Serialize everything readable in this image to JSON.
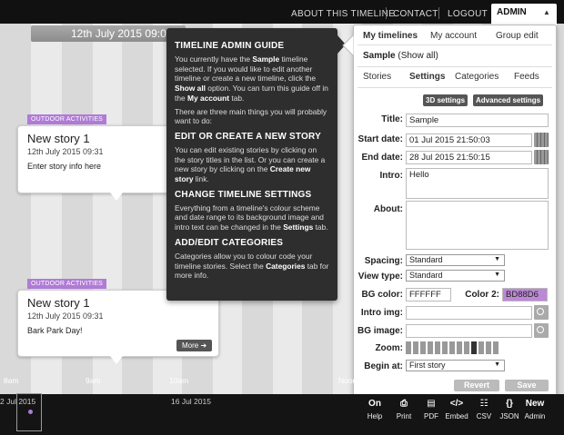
{
  "nav": {
    "about": "ABOUT THIS TIMELINE",
    "contact": "CONTACT",
    "logout": "LOGOUT",
    "admin": "ADMIN"
  },
  "timeline": {
    "header_date": "12th July 2015 09:00",
    "hours": [
      "8am",
      "9am",
      "10am",
      "Noon"
    ],
    "axis_dates": [
      "2 Jul 2015",
      "16 Jul 2015"
    ],
    "accent_color": "#b07bd6"
  },
  "stories": [
    {
      "category": "OUTDOOR ACTIVITIES",
      "title": "New story 1",
      "date": "12th July 2015 09:31",
      "text": "Enter story info here"
    },
    {
      "category": "OUTDOOR ACTIVITIES",
      "title": "New story 1",
      "date": "12th July 2015 09:31",
      "text": "Bark Park Day!",
      "more_label": "More ➜"
    }
  ],
  "guide": {
    "title": "TIMELINE ADMIN GUIDE",
    "intro_1a": "You currently have the ",
    "intro_1b": "Sample",
    "intro_1c": " timeline selected. If you would like to edit another timeline or create a new timeline, click the ",
    "intro_1d": "Show all",
    "intro_1e": " option. You can turn this guide off in the ",
    "intro_1f": "My account",
    "intro_1g": " tab.",
    "intro_2": "There are three main things you will probably want to do:",
    "s1_title": "EDIT OR CREATE A NEW STORY",
    "s1_a": "You can edit existing stories by clicking on the story titles in the list. Or you can create a new story by clicking on the ",
    "s1_b": "Create new story",
    "s1_c": " link.",
    "s2_title": "CHANGE TIMELINE SETTINGS",
    "s2_a": "Everything from a timeline's colour scheme and date range to its background image and intro text can be changed in the ",
    "s2_b": "Settings",
    "s2_c": " tab.",
    "s3_title": "ADD/EDIT CATEGORIES",
    "s3_a": "Categories allow you to colour code your timeline stories. Select the ",
    "s3_b": "Categories",
    "s3_c": " tab for more info."
  },
  "panel": {
    "tabs": [
      "My timelines",
      "My account",
      "Group edit"
    ],
    "timeline_name": "Sample",
    "show_all": "(Show all)",
    "subtabs": [
      "Stories",
      "Settings",
      "Categories",
      "Feeds"
    ],
    "btn_3d": "3D settings",
    "btn_advanced": "Advanced settings",
    "labels": {
      "title": "Title:",
      "start": "Start date:",
      "end": "End date:",
      "intro": "Intro:",
      "about": "About:",
      "spacing": "Spacing:",
      "view_type": "View type:",
      "bg_color": "BG color:",
      "color2": "Color 2:",
      "intro_img": "Intro img:",
      "bg_image": "BG image:",
      "zoom": "Zoom:",
      "begin_at": "Begin at:"
    },
    "values": {
      "title": "Sample",
      "start": "01 Jul 2015 21:50:03",
      "end": "28 Jul 2015 21:50:15",
      "intro": "Hello",
      "about": "",
      "spacing": "Standard",
      "view_type": "Standard",
      "bg_color": "FFFFFF",
      "color2": "BD88D6",
      "intro_img": "",
      "bg_image": "",
      "begin_at": "First story"
    },
    "color2_hex": "#bd88d6",
    "zoom_level": 10,
    "zoom_steps": 13,
    "revert": "Revert",
    "save": "Save"
  },
  "toolbar": [
    {
      "icon": "On",
      "label": "Help"
    },
    {
      "icon": "⎙",
      "label": "Print"
    },
    {
      "icon": "▤",
      "label": "PDF"
    },
    {
      "icon": "</>",
      "label": "Embed"
    },
    {
      "icon": "☷",
      "label": "CSV"
    },
    {
      "icon": "{}",
      "label": "JSON"
    },
    {
      "icon": "New",
      "label": "Admin"
    }
  ]
}
